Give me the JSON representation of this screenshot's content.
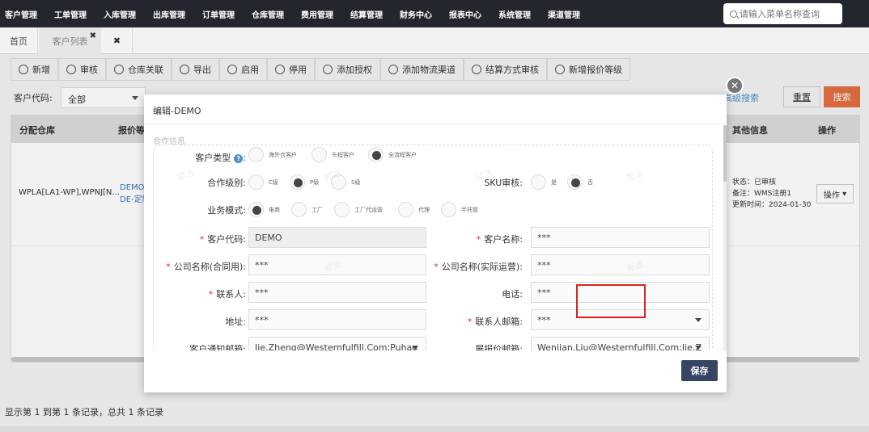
{
  "nav": {
    "menu": [
      "客户管理",
      "工单管理",
      "入库管理",
      "出库管理",
      "订单管理",
      "仓库管理",
      "费用管理",
      "结算管理",
      "财务中心",
      "报表中心",
      "系统管理",
      "渠道管理"
    ],
    "search_placeholder": "请输入菜单名称查询"
  },
  "tabs": {
    "home": "首页",
    "customer_list": "客户列表",
    "close_all": "✖",
    "close_tab": "✖"
  },
  "toolbar": [
    "新增",
    "审核",
    "仓库关联",
    "导出",
    "启用",
    "停用",
    "添加授权",
    "添加物流渠道",
    "结算方式审核",
    "新增报价等级"
  ],
  "filter": {
    "customer_code_label": "客户代码:",
    "customer_code_value": "全部",
    "advanced_search": "高级搜索",
    "reset": "重置",
    "search": "搜索"
  },
  "table": {
    "headers": [
      "分配仓库",
      "报价等",
      "其他信息",
      "操作"
    ],
    "row": {
      "warehouse": "WPLA[LA1-WP],WPNJ[N...",
      "level_line1": "DEMO-",
      "level_line2": "DE-定制",
      "status": "状态：已审核",
      "note": "备注：WMS注册1",
      "updated": "更新时间：2024-01-30",
      "action": "操作"
    }
  },
  "records_text": "显示第 1 到第 1 条记录，总共 1 条记录",
  "modal": {
    "title": "编辑-DEMO",
    "section": "合作信息",
    "customer_type": {
      "label": "客户类型",
      "help": "?",
      "options": [
        "海外仓客户",
        "头程客户",
        "全流程客户"
      ],
      "selected": "全流程客户"
    },
    "coop_level": {
      "label": "合作级别:",
      "options": [
        "C级",
        "P级",
        "S级"
      ],
      "selected": "P级"
    },
    "sku_audit": {
      "label": "SKU审核:",
      "options": [
        "是",
        "否"
      ],
      "selected": "否"
    },
    "business_mode": {
      "label": "业务模式:",
      "options": [
        "电商",
        "工厂",
        "工厂代运营",
        "代理",
        "半托管"
      ],
      "selected": "电商"
    },
    "fields": {
      "customer_code_label": "客户代码:",
      "customer_code_value": "DEMO",
      "customer_name_label": "客户名称:",
      "customer_name_value": "***",
      "company_contract_label": "公司名称(合同用):",
      "company_contract_value": "***",
      "company_actual_label": "公司名称(实际运营):",
      "company_actual_value": "***",
      "contact_label": "联系人:",
      "contact_value": "***",
      "phone_label": "电话:",
      "phone_value": "***",
      "address_label": "地址:",
      "address_value": "***",
      "contact_email_label": "联系人邮箱:",
      "contact_email_value": "***",
      "notify_email_label": "客户通知邮箱:",
      "notify_email_value": "Jie.Zheng@Westernfulfill.Com;Puhao",
      "quote_email_label": "展报价邮箱:",
      "quote_email_value": "Wenjian.Liu@Westernfulfill.Com;Jie.Z"
    },
    "save": "保存",
    "close": "✕"
  },
  "watermark": "郑洁"
}
